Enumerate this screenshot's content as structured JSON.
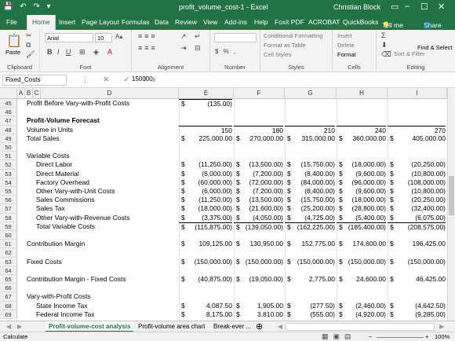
{
  "titlebar": {
    "quick_access": "💾 ↶ ↷ ▾",
    "title": "profit_volume_cost-1 - Excel",
    "user": "Christian Block"
  },
  "tabs": [
    "File",
    "Home",
    "Insert",
    "Page Layout",
    "Formulas",
    "Data",
    "Review",
    "View",
    "Add-ins",
    "Help",
    "Foxit PDF",
    "ACROBAT",
    "QuickBooks",
    "Tell me",
    "Share"
  ],
  "active_tab": "Home",
  "ribbon": {
    "paste_label": "Paste",
    "font_name": "Arial",
    "font_size": "10",
    "number_format": "",
    "conditional_formatting": "Conditional Formatting",
    "format_as_table": "Format as Table",
    "cell_styles": "Cell Styles",
    "insert": "Insert",
    "delete": "Delete",
    "format": "Format",
    "sort_filter": "Sort & Filter",
    "find_select": "Find & Select",
    "groups": {
      "clipboard": "Clipboard",
      "font": "Font",
      "alignment": "Alignment",
      "number": "Number",
      "styles": "Styles",
      "cells": "Cells",
      "editing": "Editing"
    }
  },
  "formula_bar": {
    "name_box": "Fixed_Costs",
    "buttons": "⋮ ✕ ✓ fx",
    "value": "150000"
  },
  "columns": [
    "A",
    "B",
    "C",
    "D",
    "E",
    "F",
    "G",
    "H",
    "I"
  ],
  "rows": [
    {
      "n": "45",
      "label": "Profit Before Vary-with-Profit Costs",
      "indent": 0,
      "vals": [
        {
          "d": "$",
          "v": "(135.00)"
        },
        {
          "d": "",
          "v": ""
        },
        {
          "d": "",
          "v": ""
        },
        {
          "d": "",
          "v": ""
        },
        {
          "d": "",
          "v": ""
        }
      ]
    },
    {
      "n": "46",
      "label": "",
      "indent": 0,
      "vals": []
    },
    {
      "n": "47",
      "label": "Profit-Volume Forecast",
      "indent": 0,
      "bold": true,
      "vals": []
    },
    {
      "n": "48",
      "label": "Volume in Units",
      "indent": 0,
      "vals": [
        {
          "d": "",
          "v": "150"
        },
        {
          "d": "",
          "v": "180"
        },
        {
          "d": "",
          "v": "210"
        },
        {
          "d": "",
          "v": "240"
        },
        {
          "d": "",
          "v": "270"
        }
      ]
    },
    {
      "n": "49",
      "label": "Total Sales",
      "indent": 0,
      "vals": [
        {
          "d": "$",
          "v": "225,000.00"
        },
        {
          "d": "$",
          "v": "270,000.00"
        },
        {
          "d": "$",
          "v": "315,000.00"
        },
        {
          "d": "$",
          "v": "360,000.00"
        },
        {
          "d": "$",
          "v": "405,000.00"
        }
      ]
    },
    {
      "n": "50",
      "label": "",
      "indent": 0,
      "vals": []
    },
    {
      "n": "51",
      "label": "Variable Costs",
      "indent": 0,
      "vals": []
    },
    {
      "n": "52",
      "label": "Direct Labor",
      "indent": 1,
      "vals": [
        {
          "d": "$",
          "v": "(11,250.00)"
        },
        {
          "d": "$",
          "v": "(13,500.00)"
        },
        {
          "d": "$",
          "v": "(15,750.00)"
        },
        {
          "d": "$",
          "v": "(18,000.00)"
        },
        {
          "d": "$",
          "v": "(20,250.00)"
        }
      ]
    },
    {
      "n": "53",
      "label": "Direct Material",
      "indent": 1,
      "vals": [
        {
          "d": "$",
          "v": "(6,000.00)"
        },
        {
          "d": "$",
          "v": "(7,200.00)"
        },
        {
          "d": "$",
          "v": "(8,400.00)"
        },
        {
          "d": "$",
          "v": "(9,600.00)"
        },
        {
          "d": "$",
          "v": "(10,800.00)"
        }
      ]
    },
    {
      "n": "54",
      "label": "Factory Overhead",
      "indent": 1,
      "vals": [
        {
          "d": "$",
          "v": "(60,000.00)"
        },
        {
          "d": "$",
          "v": "(72,000.00)"
        },
        {
          "d": "$",
          "v": "(84,000.00)"
        },
        {
          "d": "$",
          "v": "(96,000.00)"
        },
        {
          "d": "$",
          "v": "(108,000.00)"
        }
      ]
    },
    {
      "n": "55",
      "label": "Other Vary-with-Unit Costs",
      "indent": 1,
      "vals": [
        {
          "d": "$",
          "v": "(6,000.00)"
        },
        {
          "d": "$",
          "v": "(7,200.00)"
        },
        {
          "d": "$",
          "v": "(8,400.00)"
        },
        {
          "d": "$",
          "v": "(9,600.00)"
        },
        {
          "d": "$",
          "v": "(10,800.00)"
        }
      ]
    },
    {
      "n": "56",
      "label": "Sales Commissions",
      "indent": 1,
      "vals": [
        {
          "d": "$",
          "v": "(11,250.00)"
        },
        {
          "d": "$",
          "v": "(13,500.00)"
        },
        {
          "d": "$",
          "v": "(15,750.00)"
        },
        {
          "d": "$",
          "v": "(18,000.00)"
        },
        {
          "d": "$",
          "v": "(20,250.00)"
        }
      ]
    },
    {
      "n": "57",
      "label": "Sales Tax",
      "indent": 1,
      "vals": [
        {
          "d": "$",
          "v": "(18,000.00)"
        },
        {
          "d": "$",
          "v": "(21,600.00)"
        },
        {
          "d": "$",
          "v": "(25,200.00)"
        },
        {
          "d": "$",
          "v": "(28,800.00)"
        },
        {
          "d": "$",
          "v": "(32,400.00)"
        }
      ]
    },
    {
      "n": "58",
      "label": "Other Vary-with-Revenue Costs",
      "indent": 1,
      "vals": [
        {
          "d": "$",
          "v": "(3,375.00)"
        },
        {
          "d": "$",
          "v": "(4,050.00)"
        },
        {
          "d": "$",
          "v": "(4,725.00)"
        },
        {
          "d": "$",
          "v": "(5,400.00)"
        },
        {
          "d": "$",
          "v": "(6,075.00)"
        }
      ]
    },
    {
      "n": "59",
      "label": "Total Variable Costs",
      "indent": 1,
      "vals": [
        {
          "d": "$",
          "v": "(115,875.00)"
        },
        {
          "d": "$",
          "v": "(139,050.00)"
        },
        {
          "d": "$",
          "v": "(162,225.00)"
        },
        {
          "d": "$",
          "v": "(185,400.00)"
        },
        {
          "d": "$",
          "v": "(208,575.00)"
        }
      ]
    },
    {
      "n": "60",
      "label": "",
      "indent": 0,
      "vals": []
    },
    {
      "n": "61",
      "label": "Contribution Margin",
      "indent": 0,
      "vals": [
        {
          "d": "$",
          "v": "109,125.00"
        },
        {
          "d": "$",
          "v": "130,950.00"
        },
        {
          "d": "$",
          "v": "152,775.00"
        },
        {
          "d": "$",
          "v": "174,600.00"
        },
        {
          "d": "$",
          "v": "196,425.00"
        }
      ]
    },
    {
      "n": "62",
      "label": "",
      "indent": 0,
      "vals": []
    },
    {
      "n": "63",
      "label": "Fixed Costs",
      "indent": 0,
      "vals": [
        {
          "d": "$",
          "v": "(150,000.00)"
        },
        {
          "d": "$",
          "v": "(150,000.00)"
        },
        {
          "d": "$",
          "v": "(150,000.00)"
        },
        {
          "d": "$",
          "v": "(150,000.00)"
        },
        {
          "d": "$",
          "v": "(150,000.00)"
        }
      ]
    },
    {
      "n": "64",
      "label": "",
      "indent": 0,
      "vals": []
    },
    {
      "n": "65",
      "label": "Contribution Margin - Fixed Costs",
      "indent": 0,
      "vals": [
        {
          "d": "$",
          "v": "(40,875.00)"
        },
        {
          "d": "$",
          "v": "(19,050.00)"
        },
        {
          "d": "$",
          "v": "2,775.00"
        },
        {
          "d": "$",
          "v": "24,600.00"
        },
        {
          "d": "$",
          "v": "46,425.00"
        }
      ]
    },
    {
      "n": "66",
      "label": "",
      "indent": 0,
      "vals": []
    },
    {
      "n": "67",
      "label": "Vary-with-Profit Costs",
      "indent": 0,
      "vals": []
    },
    {
      "n": "68",
      "label": "State Income Tax",
      "indent": 1,
      "vals": [
        {
          "d": "$",
          "v": "4,087.50"
        },
        {
          "d": "$",
          "v": "1,905.00"
        },
        {
          "d": "$",
          "v": "(277.50)"
        },
        {
          "d": "$",
          "v": "(2,460.00)"
        },
        {
          "d": "$",
          "v": "(4,642.50)"
        }
      ]
    },
    {
      "n": "69",
      "label": "Federal Income Tax",
      "indent": 1,
      "vals": [
        {
          "d": "$",
          "v": "8,175.00"
        },
        {
          "d": "$",
          "v": "3,810.00"
        },
        {
          "d": "$",
          "v": "(555.00)"
        },
        {
          "d": "$",
          "v": "(4,920.00)"
        },
        {
          "d": "$",
          "v": "(9,285.00)"
        }
      ]
    }
  ],
  "sheet_tabs": [
    "Profit-volume-cost analysis",
    "Profit-volume area chart",
    "Break-ever ..."
  ],
  "active_sheet": "Profit-volume-cost analysis",
  "status": {
    "left": "Calculate",
    "zoom": "100%"
  }
}
